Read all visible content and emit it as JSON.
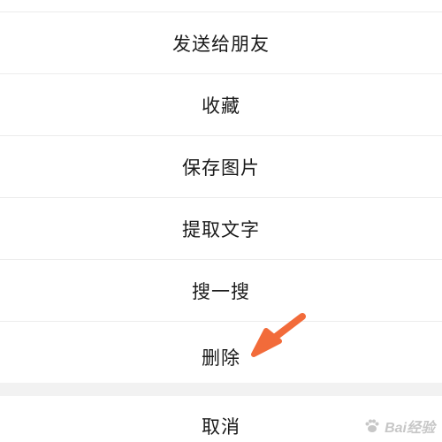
{
  "menu": {
    "items": [
      {
        "label": "发送给朋友"
      },
      {
        "label": "收藏"
      },
      {
        "label": "保存图片"
      },
      {
        "label": "提取文字"
      },
      {
        "label": "搜一搜"
      },
      {
        "label": "删除"
      }
    ],
    "cancel_label": "取消"
  },
  "annotation": {
    "arrow_color": "#f26b3a",
    "arrow_icon": "arrow-pointer-icon"
  },
  "watermark": {
    "text": "Bai经验"
  },
  "colors": {
    "divider": "#ececec",
    "gap": "#f2f2f2",
    "text": "#1a1a1a"
  }
}
